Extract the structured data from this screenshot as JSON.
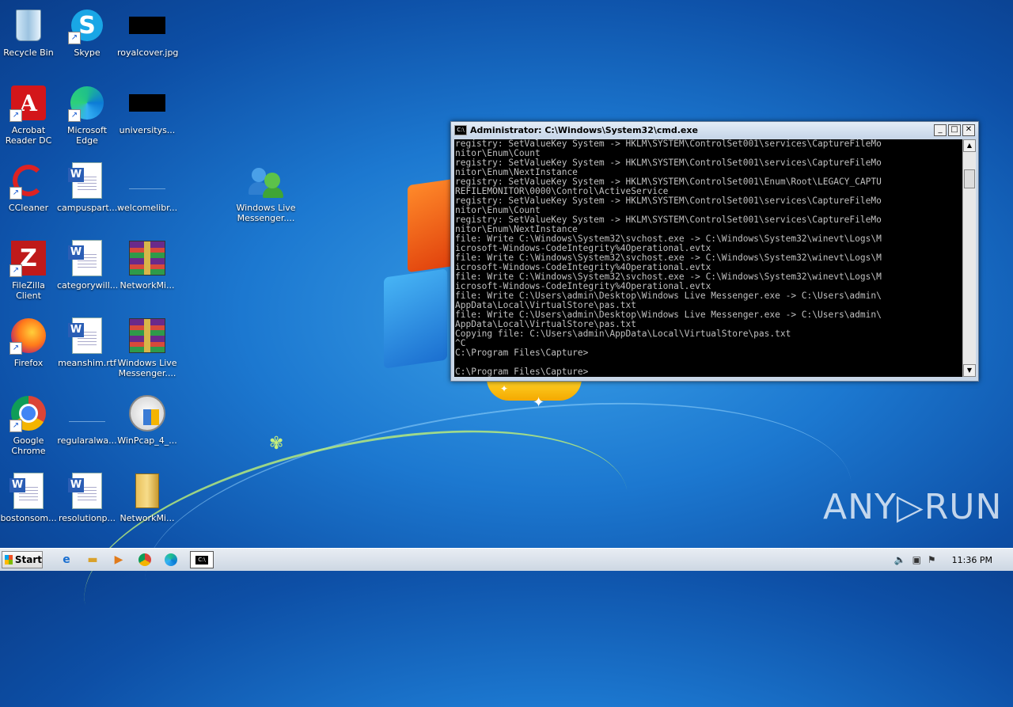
{
  "desktop": {
    "icons": [
      {
        "label": "Recycle Bin"
      },
      {
        "label": "Skype"
      },
      {
        "label": "royalcover.jpg"
      },
      {
        "label": "Acrobat Reader DC"
      },
      {
        "label": "Microsoft Edge"
      },
      {
        "label": "universitys..."
      },
      {
        "label": "CCleaner"
      },
      {
        "label": "campuspart..."
      },
      {
        "label": "welcomelibr..."
      },
      {
        "label": "Windows Live Messenger...."
      },
      {
        "label": "FileZilla Client"
      },
      {
        "label": "categorywill..."
      },
      {
        "label": "NetworkMi..."
      },
      {
        "label": "Firefox"
      },
      {
        "label": "meanshim.rtf"
      },
      {
        "label": "Windows Live Messenger...."
      },
      {
        "label": "Google Chrome"
      },
      {
        "label": "regularalwa..."
      },
      {
        "label": "WinPcap_4_..."
      },
      {
        "label": "bostonsom..."
      },
      {
        "label": "resolutionp..."
      },
      {
        "label": "NetworkMi..."
      }
    ]
  },
  "cmd_window": {
    "title": "Administrator: C:\\Windows\\System32\\cmd.exe",
    "minimize": "_",
    "maximize": "□",
    "close": "✕",
    "output": "registry: SetValueKey System -> HKLM\\SYSTEM\\ControlSet001\\services\\CaptureFileMo\nnitor\\Enum\\Count\nregistry: SetValueKey System -> HKLM\\SYSTEM\\ControlSet001\\services\\CaptureFileMo\nnitor\\Enum\\NextInstance\nregistry: SetValueKey System -> HKLM\\SYSTEM\\ControlSet001\\Enum\\Root\\LEGACY_CAPTU\nREFILEMONITOR\\0000\\Control\\ActiveService\nregistry: SetValueKey System -> HKLM\\SYSTEM\\ControlSet001\\services\\CaptureFileMo\nnitor\\Enum\\Count\nregistry: SetValueKey System -> HKLM\\SYSTEM\\ControlSet001\\services\\CaptureFileMo\nnitor\\Enum\\NextInstance\nfile: Write C:\\Windows\\System32\\svchost.exe -> C:\\Windows\\System32\\winevt\\Logs\\M\nicrosoft-Windows-CodeIntegrity%4Operational.evtx\nfile: Write C:\\Windows\\System32\\svchost.exe -> C:\\Windows\\System32\\winevt\\Logs\\M\nicrosoft-Windows-CodeIntegrity%4Operational.evtx\nfile: Write C:\\Windows\\System32\\svchost.exe -> C:\\Windows\\System32\\winevt\\Logs\\M\nicrosoft-Windows-CodeIntegrity%4Operational.evtx\nfile: Write C:\\Users\\admin\\Desktop\\Windows Live Messenger.exe -> C:\\Users\\admin\\\nAppData\\Local\\VirtualStore\\pas.txt\nfile: Write C:\\Users\\admin\\Desktop\\Windows Live Messenger.exe -> C:\\Users\\admin\\\nAppData\\Local\\VirtualStore\\pas.txt\nCopying file: C:\\Users\\admin\\AppData\\Local\\VirtualStore\\pas.txt\n^C\nC:\\Program Files\\Capture>\n\nC:\\Program Files\\Capture>"
  },
  "watermark": "ANY▷RUN",
  "taskbar": {
    "start_label": "Start",
    "clock": "11:36 PM"
  }
}
